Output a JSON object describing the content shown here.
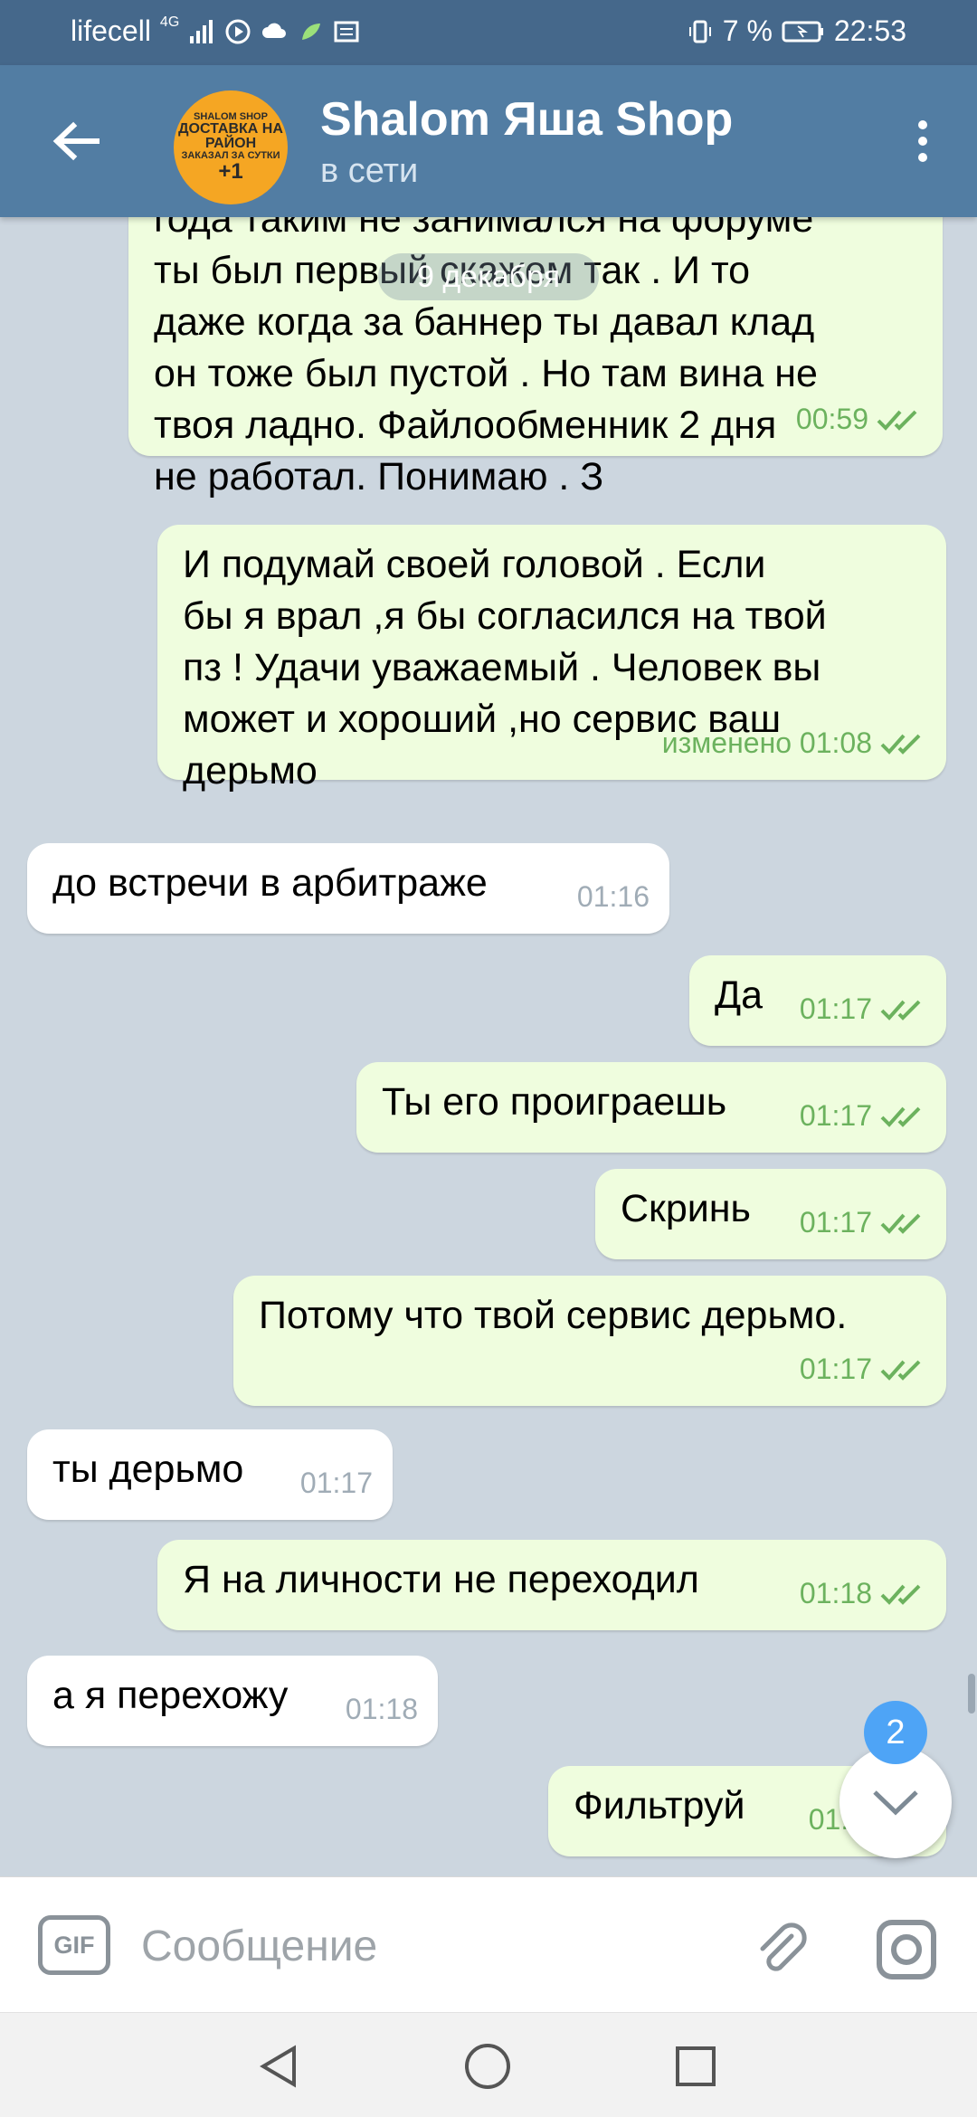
{
  "status_bar": {
    "carrier": "lifecell",
    "network": "4G",
    "battery": "7 %",
    "time": "22:53"
  },
  "header": {
    "title": "Shalom Яша Shop",
    "status": "в сети",
    "avatar_text": {
      "line1": "SHALOM SHOP",
      "line2": "ДОСТАВКА НА РАЙОН",
      "line3": "ЗАКАЗАЛ ЗА СУТКИ",
      "line4": "+1"
    }
  },
  "date_pill": "9 декабря",
  "messages": [
    {
      "direction": "out",
      "lines": [
        "года таким не занимался на форуме",
        "ты был первый скажем так . И то",
        "даже когда за баннер ты давал клад",
        "он тоже был пустой . Но там вина не",
        "твоя ладно. Файлообменник 2 дня",
        "не работал.  Понимаю . З"
      ],
      "time": "00:59"
    },
    {
      "direction": "out",
      "lines": [
        "И подумай своей головой . Если",
        "бы я врал ,я бы согласился на твой",
        "пз ! Удачи уважаемый . Человек вы",
        "может и хороший ,но сервис ваш",
        "дерьмо"
      ],
      "time": "изменено 01:08"
    },
    {
      "direction": "in",
      "lines": [
        "до встречи в арбитраже"
      ],
      "time": "01:16"
    },
    {
      "direction": "out",
      "lines": [
        "Да"
      ],
      "time": "01:17"
    },
    {
      "direction": "out",
      "lines": [
        "Ты его проиграешь"
      ],
      "time": "01:17"
    },
    {
      "direction": "out",
      "lines": [
        "Скринь"
      ],
      "time": "01:17"
    },
    {
      "direction": "out",
      "lines": [
        "Потому что твой сервис дерьмо."
      ],
      "time": "01:17"
    },
    {
      "direction": "in",
      "lines": [
        "ты дерьмо"
      ],
      "time": "01:17"
    },
    {
      "direction": "out",
      "lines": [
        "Я на личности  не переходил"
      ],
      "time": "01:18"
    },
    {
      "direction": "in",
      "lines": [
        "а я перехожу"
      ],
      "time": "01:18"
    },
    {
      "direction": "out",
      "lines": [
        "Фильтруй"
      ],
      "time": "01:1"
    }
  ],
  "scroll_down": {
    "badge": "2"
  },
  "input": {
    "gif_label": "GIF",
    "placeholder": "Сообщение"
  },
  "colors": {
    "header": "#527da3",
    "status_bar": "#45688b",
    "outgoing_bubble": "#effdde",
    "incoming_bubble": "#ffffff",
    "chat_background": "#ccd6df",
    "time_out": "#6cb25e",
    "badge": "#4ea4f6"
  },
  "icons": {
    "back": "arrow-left-icon",
    "menu": "more-vertical-icon",
    "attach": "paperclip-icon",
    "camera": "camera-icon",
    "scroll_down": "chevron-down-icon",
    "read": "double-check-icon"
  }
}
